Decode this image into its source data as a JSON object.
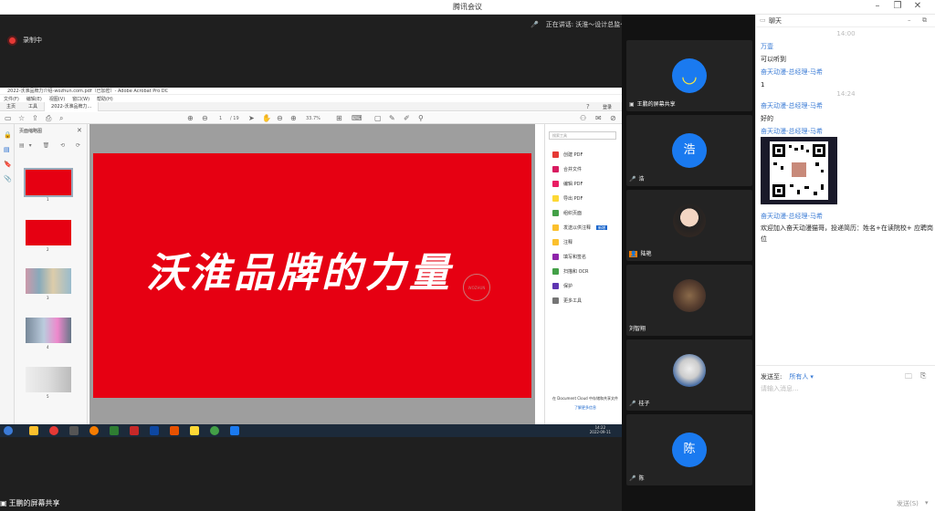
{
  "window": {
    "title": "腾讯会议"
  },
  "stage": {
    "recording_label": "录制中",
    "speaker_text": "正在讲话: 沃淮～设计总监～王...",
    "share_label": "王鹏的屏幕共享"
  },
  "acrobat": {
    "title": "2022-沃淮品牌力介绍-wozhun.com.pdf（已加密）- Adobe Acrobat Pro DC",
    "menu": [
      "文件(F)",
      "编辑(E)",
      "视图(V)",
      "窗口(W)",
      "帮助(H)"
    ],
    "tabs": {
      "home": "主页",
      "tools": "工具",
      "doc": "2022-沃淮品牌力..."
    },
    "toolbar": {
      "page_current": "1",
      "page_total": "/ 19",
      "zoom": "33.7%",
      "login": "登录"
    },
    "thumbnails_header": "页面缩略图",
    "thumb_numbers": [
      "1",
      "2",
      "3",
      "4",
      "5"
    ],
    "slide_text": "沃淮品牌的力量",
    "seal_text": "WOZHUN",
    "tools_search_placeholder": "搜索工具",
    "tools": [
      "创建 PDF",
      "合并文件",
      "编辑 PDF",
      "导出 PDF",
      "组织页面",
      "发送以供注释",
      "注释",
      "填写和签名",
      "扫描和 OCR",
      "保护",
      "更多工具"
    ],
    "new_badge": "新增",
    "cloud_text": "在 Document Cloud 中存储和共享文件",
    "cloud_link": "了解更多信息",
    "taskbar_time": "14:22",
    "taskbar_date": "2022-09-11"
  },
  "participants": [
    {
      "name": "王鹏的屏幕共享",
      "avatar": "smiley",
      "avatar_color": "#1a7af0"
    },
    {
      "name": "浩",
      "avatar": "浩",
      "avatar_color": "#1a7af0"
    },
    {
      "name": "陆艳",
      "avatar": "photo"
    },
    {
      "name": "刘智翔",
      "avatar": "photo"
    },
    {
      "name": "桂子",
      "avatar": "dog"
    },
    {
      "name": "陈",
      "avatar": "陈",
      "avatar_color": "#1a7af0"
    }
  ],
  "chat": {
    "header": "聊天",
    "time1": "14:00",
    "messages": [
      {
        "sender": "万壹",
        "text": "可以听到"
      },
      {
        "sender": "奋天动漫-总经理-马希",
        "text": "1"
      },
      {
        "sender": "奋天动漫-总经理-马希",
        "text": "好的"
      },
      {
        "sender": "奋天动漫-总经理-马希",
        "text": ""
      },
      {
        "sender": "奋天动漫-总经理-马希",
        "text": "欢迎加入奋天动漫猫哥，投递简历：姓名+在读院校+ 应聘岗位"
      }
    ],
    "time2": "14:24",
    "send_to_label": "发送至:",
    "send_to_value": "所有人",
    "input_placeholder": "请输入消息...",
    "send_button": "发送(S)"
  },
  "colors": {
    "accent": "#1a7af0",
    "slide_red": "#e60012",
    "chat_name": "#3a7bd5"
  }
}
